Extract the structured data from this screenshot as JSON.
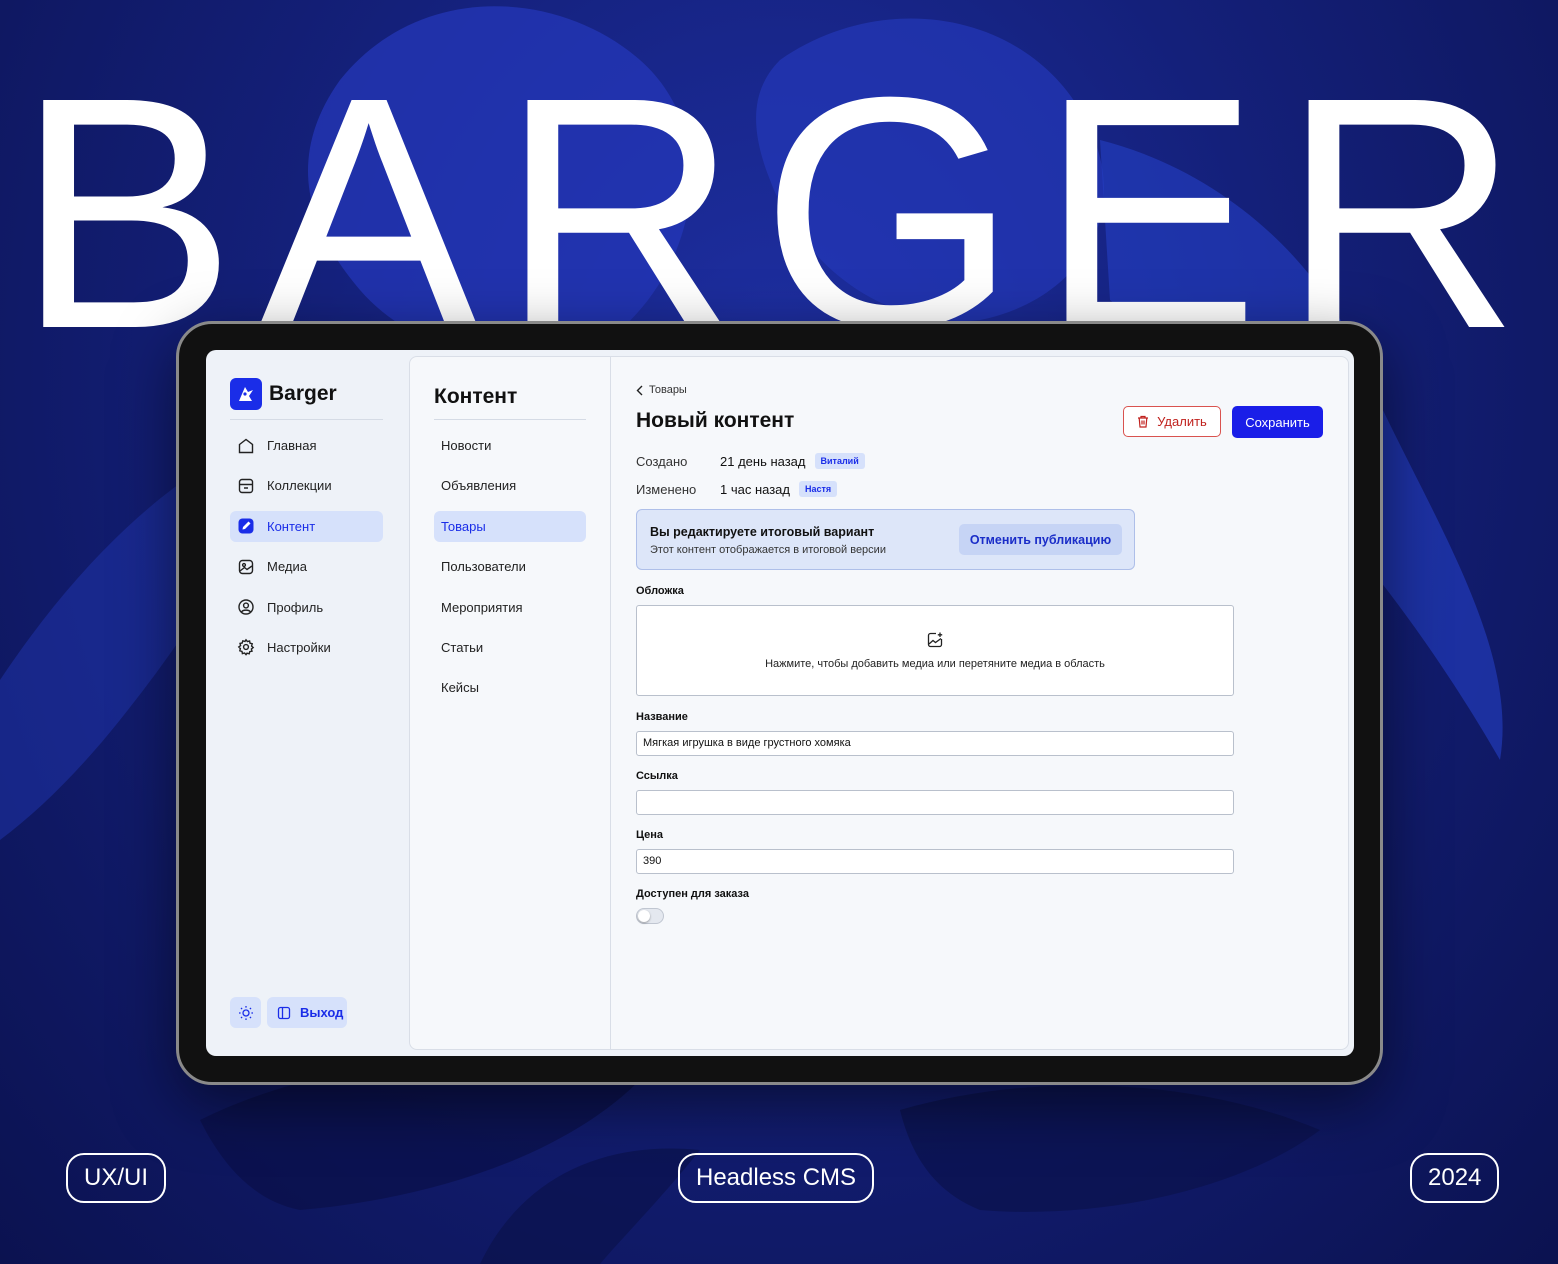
{
  "hero": {
    "title": "BARGER"
  },
  "pills": {
    "left": "UX/UI",
    "center": "Headless CMS",
    "right": "2024"
  },
  "colors": {
    "accent": "#1a1ee8",
    "accent_light": "#d6e1fb",
    "danger": "#c0221e",
    "background": "#14207a"
  },
  "app": {
    "logo_text": "Barger",
    "sidebar": {
      "items": [
        {
          "label": "Главная",
          "icon": "home-icon",
          "active": false
        },
        {
          "label": "Коллекции",
          "icon": "collections-icon",
          "active": false
        },
        {
          "label": "Контент",
          "icon": "content-icon",
          "active": true
        },
        {
          "label": "Медиа",
          "icon": "media-icon",
          "active": false
        },
        {
          "label": "Профиль",
          "icon": "profile-icon",
          "active": false
        },
        {
          "label": "Настройки",
          "icon": "settings-icon",
          "active": false
        }
      ],
      "theme_icon": "sun-icon",
      "logout_label": "Выход",
      "logout_icon": "logout-icon"
    },
    "content_nav": {
      "title": "Контент",
      "items": [
        {
          "label": "Новости",
          "active": false
        },
        {
          "label": "Объявления",
          "active": false
        },
        {
          "label": "Товары",
          "active": true
        },
        {
          "label": "Пользователи",
          "active": false
        },
        {
          "label": "Мероприятия",
          "active": false
        },
        {
          "label": "Статьи",
          "active": false
        },
        {
          "label": "Кейсы",
          "active": false
        }
      ]
    },
    "editor": {
      "breadcrumb": "Товары",
      "title": "Новый контент",
      "delete_label": "Удалить",
      "save_label": "Сохранить",
      "created": {
        "label": "Создано",
        "value": "21 день назад",
        "user": "Виталий"
      },
      "modified": {
        "label": "Изменено",
        "value": "1 час назад",
        "user": "Настя"
      },
      "notice": {
        "title": "Вы редактируете итоговый вариант",
        "subtitle": "Этот контент отображается в итоговой версии",
        "action": "Отменить публикацию"
      },
      "cover": {
        "label": "Обложка",
        "hint": "Нажмите, чтобы добавить медиа или перетяните медиа в область"
      },
      "fields": {
        "name": {
          "label": "Название",
          "value": "Мягкая игрушка в виде грустного хомяка"
        },
        "link": {
          "label": "Ссылка",
          "value": ""
        },
        "price": {
          "label": "Цена",
          "value": "390"
        },
        "available": {
          "label": "Доступен для заказа",
          "value": false
        }
      }
    }
  }
}
